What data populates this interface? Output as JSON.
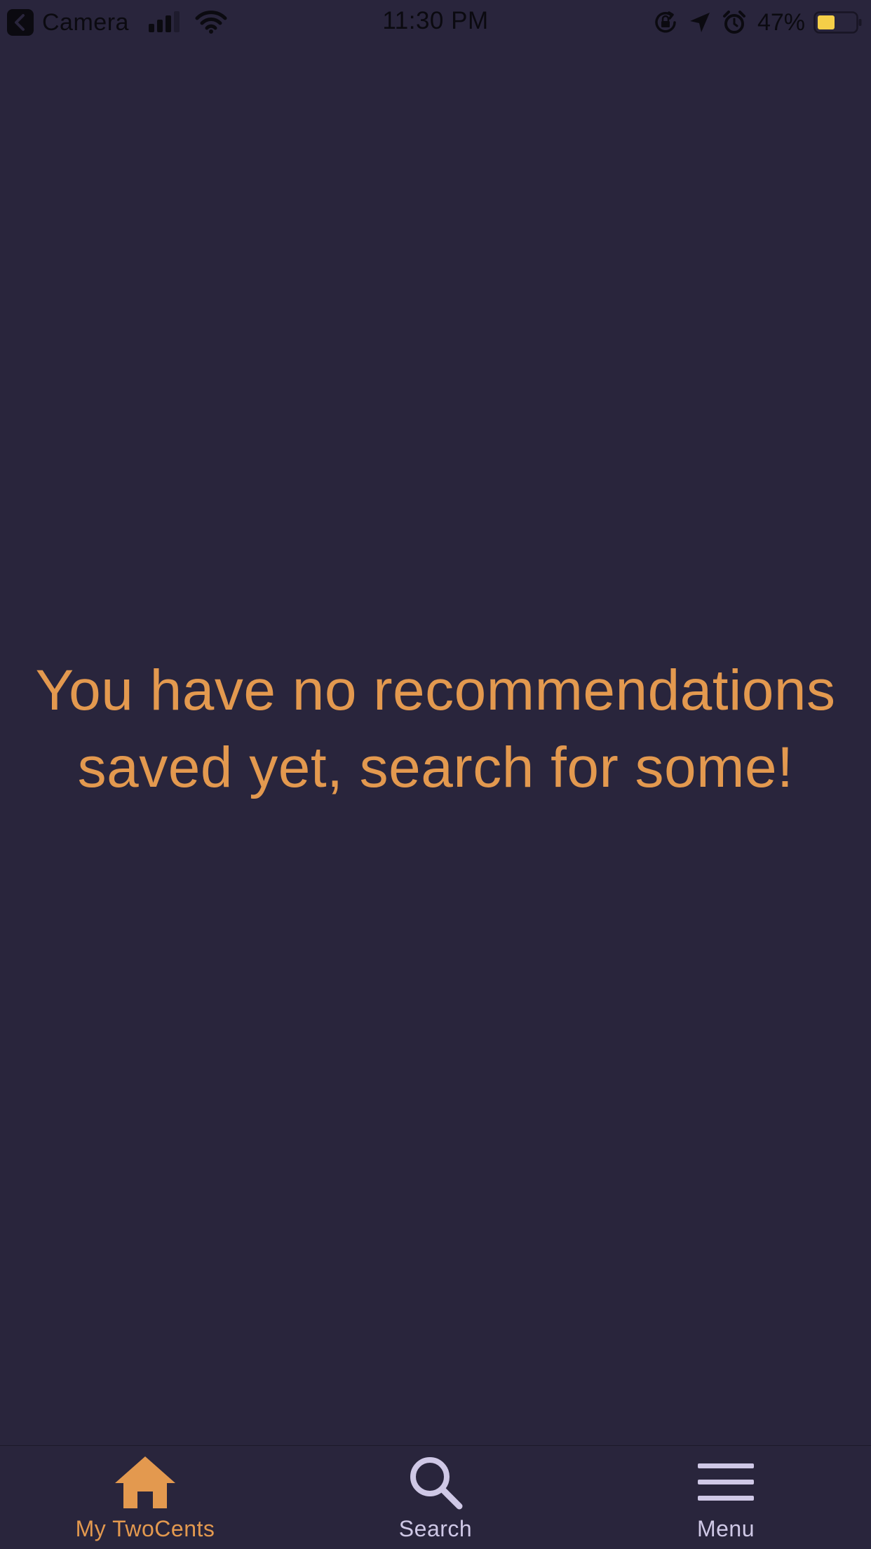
{
  "status_bar": {
    "back_app_label": "Camera",
    "time": "11:30 PM",
    "battery_percent": "47%",
    "battery_level": 0.47,
    "icons": [
      "back-arrow-icon",
      "cellular-signal-icon",
      "wifi-icon",
      "rotation-lock-icon",
      "location-icon",
      "alarm-icon",
      "battery-icon"
    ]
  },
  "main": {
    "empty_message": "You have no recommendations saved yet, search for some!"
  },
  "tab_bar": {
    "tabs": [
      {
        "label": "My TwoCents",
        "icon": "home-icon",
        "active": true
      },
      {
        "label": "Search",
        "icon": "search-icon",
        "active": false
      },
      {
        "label": "Menu",
        "icon": "menu-icon",
        "active": false
      }
    ]
  },
  "colors": {
    "background": "#29253c",
    "accent": "#e3994f",
    "inactive_tab": "#cfc8e6",
    "status_text": "#0b0a10",
    "battery_fill": "#f5cf48"
  }
}
